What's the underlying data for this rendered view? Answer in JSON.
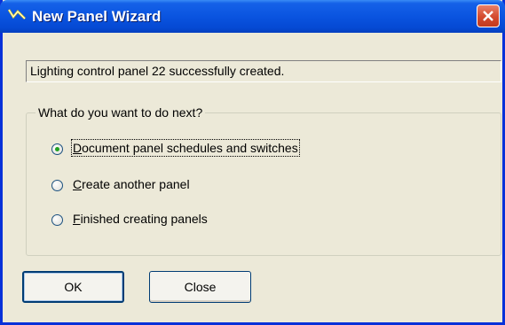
{
  "window": {
    "title": "New Panel Wizard",
    "title_icon": "wizard-icon"
  },
  "status_text": "Lighting control panel 22 successfully created.",
  "group": {
    "label": "What do you want to do next?",
    "options": [
      {
        "mnemonic": "D",
        "rest": "ocument panel schedules and switches",
        "selected": true
      },
      {
        "mnemonic": "C",
        "rest": "reate another panel",
        "selected": false
      },
      {
        "mnemonic": "F",
        "rest": "inished creating panels",
        "selected": false
      }
    ]
  },
  "buttons": {
    "ok_label": "OK",
    "close_label": "Close"
  },
  "colors": {
    "titlebar": "#0a54e0",
    "close_button": "#d44a2e",
    "dialog_bg": "#ece9d8"
  }
}
